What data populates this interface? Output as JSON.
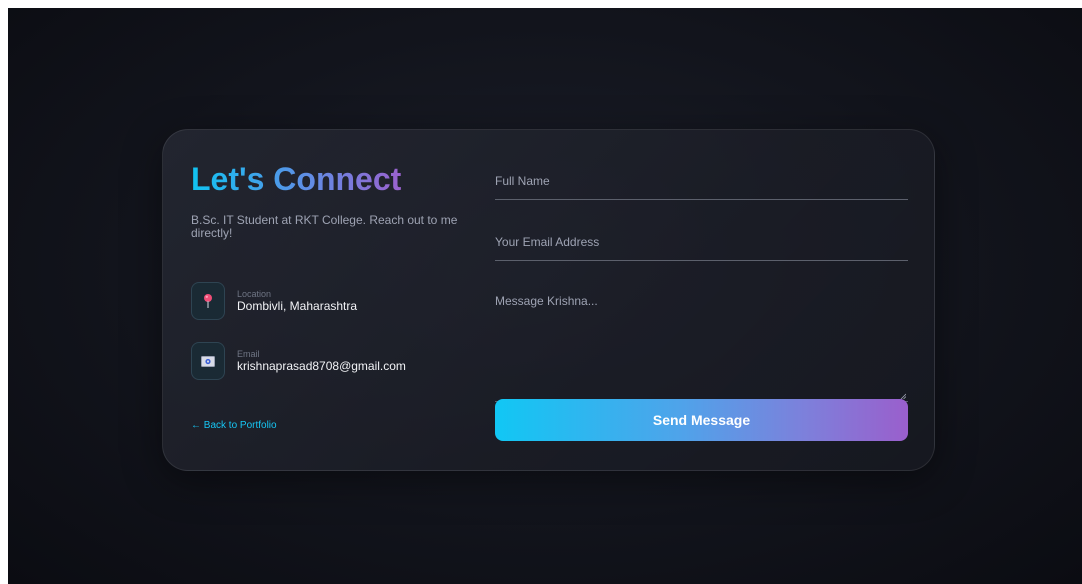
{
  "contact": {
    "title": "Let's Connect",
    "subtitle": "B.Sc. IT Student at RKT College. Reach out to me directly!",
    "location": {
      "icon": "location-pin-icon",
      "label": "Location",
      "value": "Dombivli, Maharashtra"
    },
    "email": {
      "icon": "email-icon",
      "label": "Email",
      "value": "krishnaprasad8708@gmail.com"
    },
    "back_link": "← Back to Portfolio"
  },
  "form": {
    "name_placeholder": "Full Name",
    "email_placeholder": "Your Email Address",
    "message_placeholder": "Message Krishna...",
    "submit_label": "Send Message"
  },
  "colors": {
    "accent_start": "#11c7f4",
    "accent_end": "#9a5fcc",
    "link": "#16c6f4",
    "background": "#12141c"
  }
}
